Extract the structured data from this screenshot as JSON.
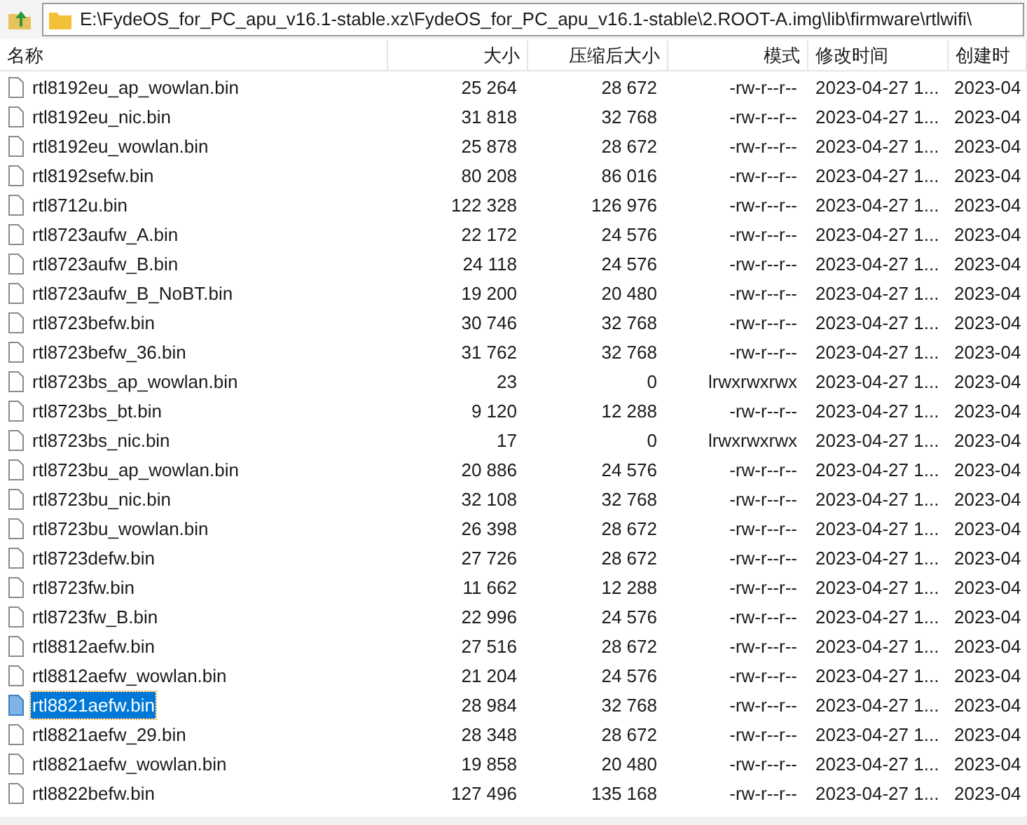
{
  "address_bar": {
    "path": "E:\\FydeOS_for_PC_apu_v16.1-stable.xz\\FydeOS_for_PC_apu_v16.1-stable\\2.ROOT-A.img\\lib\\firmware\\rtlwifi\\"
  },
  "table": {
    "columns": [
      "名称",
      "大小",
      "压缩后大小",
      "模式",
      "修改时间",
      "创建时"
    ],
    "rows": [
      {
        "name": "rtl8192eu_ap_wowlan.bin",
        "size": "25 264",
        "packed": "28 672",
        "mode": "-rw-r--r--",
        "modified": "2023-04-27 1...",
        "created": "2023-04",
        "selected": false
      },
      {
        "name": "rtl8192eu_nic.bin",
        "size": "31 818",
        "packed": "32 768",
        "mode": "-rw-r--r--",
        "modified": "2023-04-27 1...",
        "created": "2023-04",
        "selected": false
      },
      {
        "name": "rtl8192eu_wowlan.bin",
        "size": "25 878",
        "packed": "28 672",
        "mode": "-rw-r--r--",
        "modified": "2023-04-27 1...",
        "created": "2023-04",
        "selected": false
      },
      {
        "name": "rtl8192sefw.bin",
        "size": "80 208",
        "packed": "86 016",
        "mode": "-rw-r--r--",
        "modified": "2023-04-27 1...",
        "created": "2023-04",
        "selected": false
      },
      {
        "name": "rtl8712u.bin",
        "size": "122 328",
        "packed": "126 976",
        "mode": "-rw-r--r--",
        "modified": "2023-04-27 1...",
        "created": "2023-04",
        "selected": false
      },
      {
        "name": "rtl8723aufw_A.bin",
        "size": "22 172",
        "packed": "24 576",
        "mode": "-rw-r--r--",
        "modified": "2023-04-27 1...",
        "created": "2023-04",
        "selected": false
      },
      {
        "name": "rtl8723aufw_B.bin",
        "size": "24 118",
        "packed": "24 576",
        "mode": "-rw-r--r--",
        "modified": "2023-04-27 1...",
        "created": "2023-04",
        "selected": false
      },
      {
        "name": "rtl8723aufw_B_NoBT.bin",
        "size": "19 200",
        "packed": "20 480",
        "mode": "-rw-r--r--",
        "modified": "2023-04-27 1...",
        "created": "2023-04",
        "selected": false
      },
      {
        "name": "rtl8723befw.bin",
        "size": "30 746",
        "packed": "32 768",
        "mode": "-rw-r--r--",
        "modified": "2023-04-27 1...",
        "created": "2023-04",
        "selected": false
      },
      {
        "name": "rtl8723befw_36.bin",
        "size": "31 762",
        "packed": "32 768",
        "mode": "-rw-r--r--",
        "modified": "2023-04-27 1...",
        "created": "2023-04",
        "selected": false
      },
      {
        "name": "rtl8723bs_ap_wowlan.bin",
        "size": "23",
        "packed": "0",
        "mode": "lrwxrwxrwx",
        "modified": "2023-04-27 1...",
        "created": "2023-04",
        "selected": false
      },
      {
        "name": "rtl8723bs_bt.bin",
        "size": "9 120",
        "packed": "12 288",
        "mode": "-rw-r--r--",
        "modified": "2023-04-27 1...",
        "created": "2023-04",
        "selected": false
      },
      {
        "name": "rtl8723bs_nic.bin",
        "size": "17",
        "packed": "0",
        "mode": "lrwxrwxrwx",
        "modified": "2023-04-27 1...",
        "created": "2023-04",
        "selected": false
      },
      {
        "name": "rtl8723bu_ap_wowlan.bin",
        "size": "20 886",
        "packed": "24 576",
        "mode": "-rw-r--r--",
        "modified": "2023-04-27 1...",
        "created": "2023-04",
        "selected": false
      },
      {
        "name": "rtl8723bu_nic.bin",
        "size": "32 108",
        "packed": "32 768",
        "mode": "-rw-r--r--",
        "modified": "2023-04-27 1...",
        "created": "2023-04",
        "selected": false
      },
      {
        "name": "rtl8723bu_wowlan.bin",
        "size": "26 398",
        "packed": "28 672",
        "mode": "-rw-r--r--",
        "modified": "2023-04-27 1...",
        "created": "2023-04",
        "selected": false
      },
      {
        "name": "rtl8723defw.bin",
        "size": "27 726",
        "packed": "28 672",
        "mode": "-rw-r--r--",
        "modified": "2023-04-27 1...",
        "created": "2023-04",
        "selected": false
      },
      {
        "name": "rtl8723fw.bin",
        "size": "11 662",
        "packed": "12 288",
        "mode": "-rw-r--r--",
        "modified": "2023-04-27 1...",
        "created": "2023-04",
        "selected": false
      },
      {
        "name": "rtl8723fw_B.bin",
        "size": "22 996",
        "packed": "24 576",
        "mode": "-rw-r--r--",
        "modified": "2023-04-27 1...",
        "created": "2023-04",
        "selected": false
      },
      {
        "name": "rtl8812aefw.bin",
        "size": "27 516",
        "packed": "28 672",
        "mode": "-rw-r--r--",
        "modified": "2023-04-27 1...",
        "created": "2023-04",
        "selected": false
      },
      {
        "name": "rtl8812aefw_wowlan.bin",
        "size": "21 204",
        "packed": "24 576",
        "mode": "-rw-r--r--",
        "modified": "2023-04-27 1...",
        "created": "2023-04",
        "selected": false
      },
      {
        "name": "rtl8821aefw.bin",
        "size": "28 984",
        "packed": "32 768",
        "mode": "-rw-r--r--",
        "modified": "2023-04-27 1...",
        "created": "2023-04",
        "selected": true
      },
      {
        "name": "rtl8821aefw_29.bin",
        "size": "28 348",
        "packed": "28 672",
        "mode": "-rw-r--r--",
        "modified": "2023-04-27 1...",
        "created": "2023-04",
        "selected": false
      },
      {
        "name": "rtl8821aefw_wowlan.bin",
        "size": "19 858",
        "packed": "20 480",
        "mode": "-rw-r--r--",
        "modified": "2023-04-27 1...",
        "created": "2023-04",
        "selected": false
      },
      {
        "name": "rtl8822befw.bin",
        "size": "127 496",
        "packed": "135 168",
        "mode": "-rw-r--r--",
        "modified": "2023-04-27 1...",
        "created": "2023-04",
        "selected": false
      }
    ]
  }
}
